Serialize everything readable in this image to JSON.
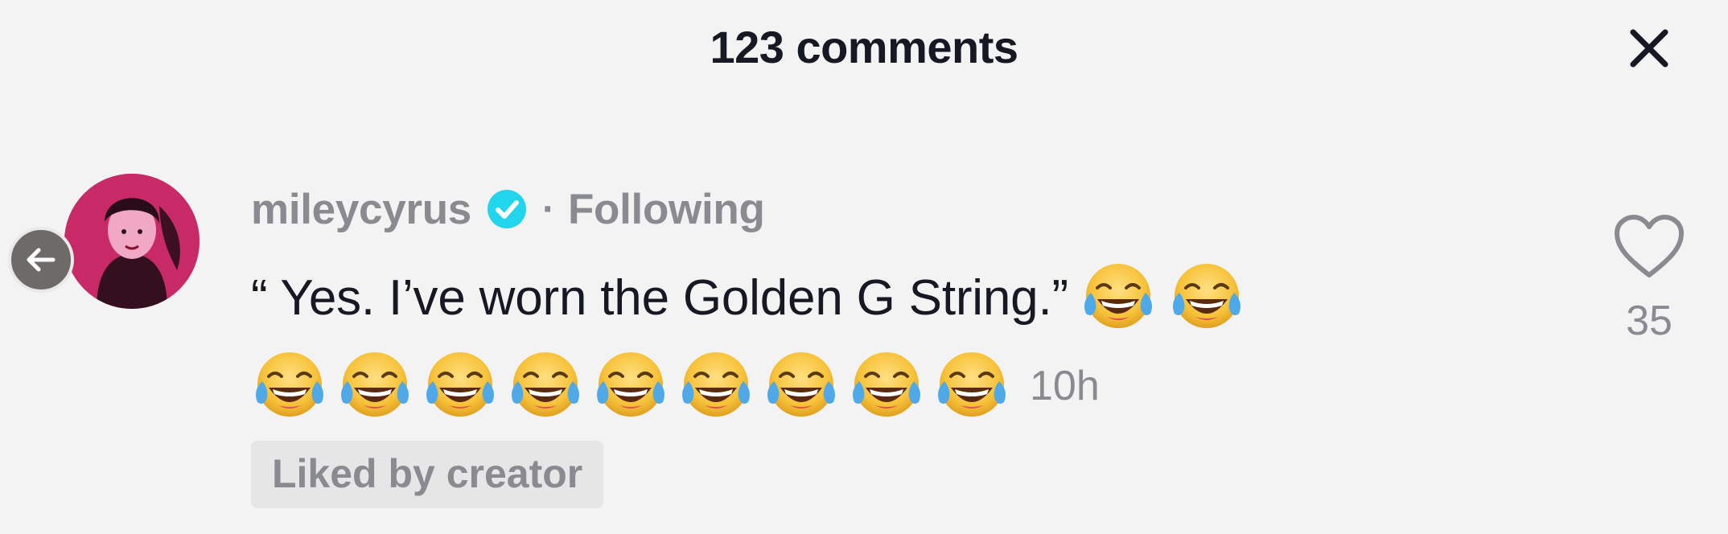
{
  "header": {
    "title": "123 comments",
    "close_icon": "close-icon"
  },
  "navigation": {
    "back_icon": "arrow-left-icon"
  },
  "comment": {
    "username": "mileycyrus",
    "verified_icon": "verified-badge-icon",
    "separator": "·",
    "follow_status": "Following",
    "text": "“ Yes. I’ve worn the Golden G String.”",
    "emoji": "face-with-tears-of-joy",
    "emoji_count_line1": 2,
    "emoji_count_line2": 9,
    "time": "10h",
    "liked_badge": "Liked by creator",
    "like_icon": "heart-outline-icon",
    "like_count": "35"
  },
  "colors": {
    "background": "#f3f3f3",
    "primary_text": "#161823",
    "secondary_text": "#8a8b91",
    "verified": "#20d5ec",
    "avatar_tint": "#d2306e"
  }
}
